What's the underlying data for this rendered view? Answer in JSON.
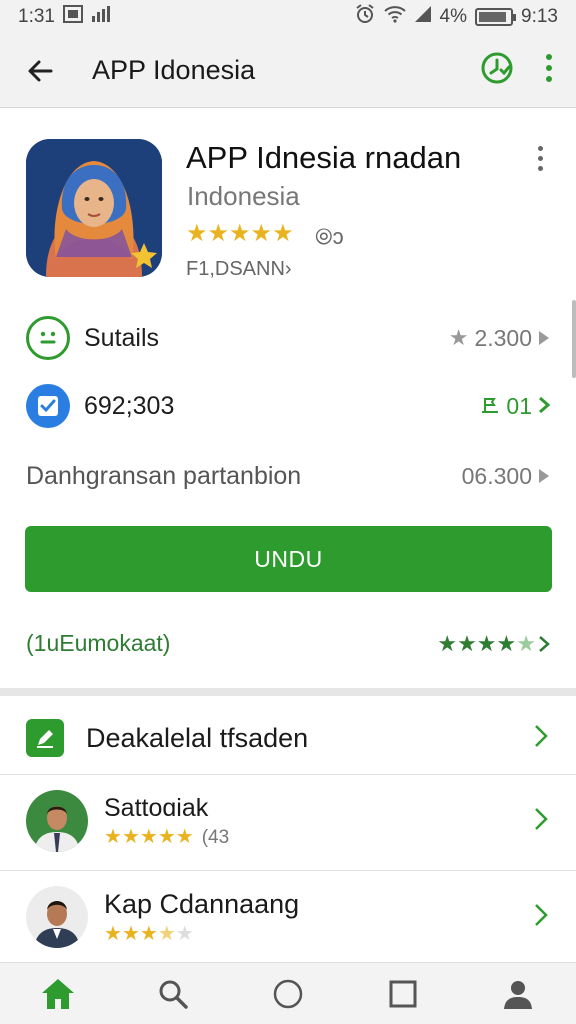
{
  "status_bar": {
    "time": "1:31",
    "left_icons": [
      "image-icon",
      "signal-icon"
    ],
    "right_icons": [
      "alarm-icon",
      "wifi-icon",
      "cell-signal-icon"
    ],
    "battery_text": "4%",
    "battery_level": 0.9,
    "clock_right": "9:13"
  },
  "app_bar": {
    "title": "APP Idonesia",
    "back_icon": "arrow-left-icon",
    "actions": [
      "clock-check-icon",
      "more-vertical-icon"
    ]
  },
  "app": {
    "name": "APP Idnesia rnadan",
    "developer": "Indonesia",
    "rating_stars": 5,
    "rating_extra": "⦾ɔ",
    "small_info": "F1,DSANN›",
    "icon": "woman-hijab-avatar",
    "menu_icon": "more-vertical-icon"
  },
  "rows": [
    {
      "icon": "smiley-icon",
      "label": "Sutails",
      "value": "2.300"
    },
    {
      "icon": "badge-check-icon",
      "label": "692;303",
      "value": "01"
    },
    {
      "label": "Danhgransan partanbion",
      "value": "06.300"
    }
  ],
  "install_button": {
    "label": "UNDU"
  },
  "review_link": {
    "label": "(1uEumokaat)",
    "stars": 4
  },
  "list": [
    {
      "icon": "edit-square-icon",
      "title": "Deakalelal tfsaden"
    },
    {
      "avatar": "man-avatar-1",
      "title": "Sattoɑiak",
      "stars": 5,
      "count": "(43"
    },
    {
      "avatar": "man-avatar-2",
      "title": "Kap Cdannaang",
      "stars": 3.5
    }
  ],
  "bottom_nav": [
    "home-icon",
    "search-icon",
    "circle-icon",
    "square-icon",
    "profile-icon"
  ],
  "colors": {
    "accent": "#2e9b2e",
    "star": "#e9b320",
    "star_green": "#2e7d32",
    "app_icon_bg": "#1d3f7a"
  }
}
